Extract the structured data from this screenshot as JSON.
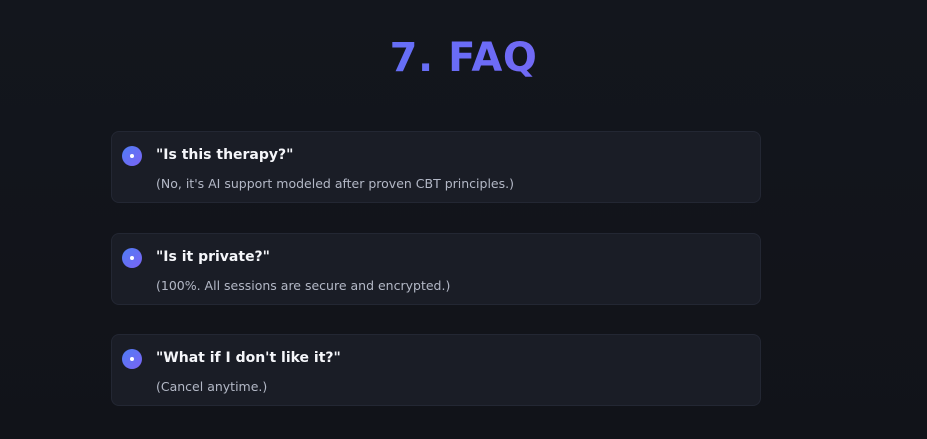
{
  "page": {
    "title": "7. FAQ"
  },
  "faq": {
    "items": [
      {
        "question": "\"Is this therapy?\"",
        "answer": "(No, it's AI support modeled after proven CBT principles.)"
      },
      {
        "question": "\"Is it private?\"",
        "answer": "(100%. All sessions are secure and encrypted.)"
      },
      {
        "question": "\"What if I don't like it?\"",
        "answer": "(Cancel anytime.)"
      }
    ]
  },
  "icons": {
    "bullet": "bullet-dot-icon"
  },
  "colors": {
    "background": "#13161d",
    "card": "#1a1d26",
    "accent_start": "#4f7df5",
    "accent_end": "#9a5cf0",
    "question_text": "#f5f6fa",
    "answer_text": "#b3b8c6"
  }
}
